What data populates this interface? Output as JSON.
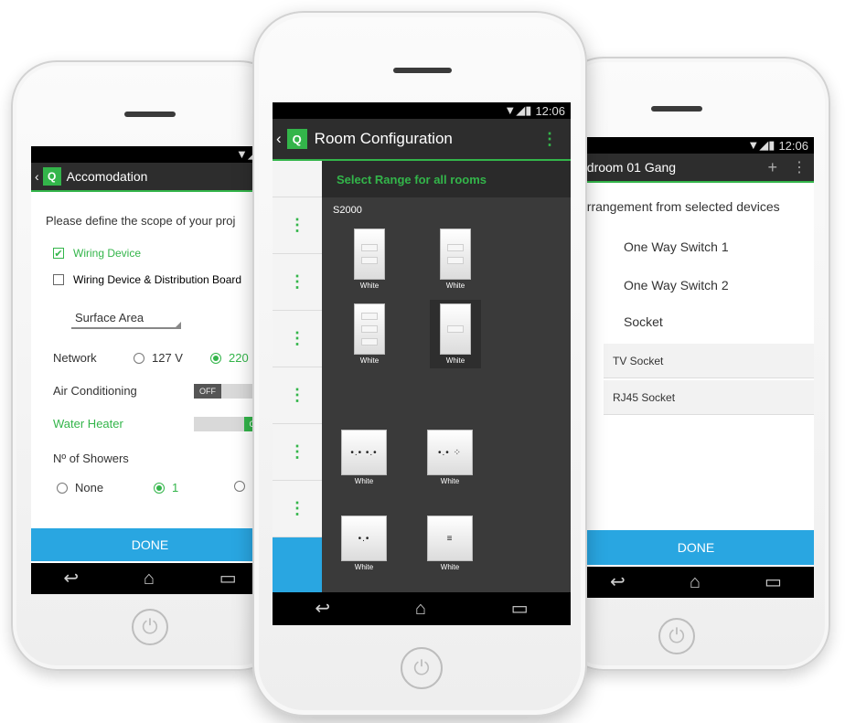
{
  "colors": {
    "accent_green": "#33b54a",
    "done_blue": "#29a6e1",
    "actionbar": "#2d2d2d"
  },
  "left": {
    "status_icons": "▼◢▮",
    "title": "Accomodation",
    "intro": "Please define the scope of your proj",
    "option_wiring": "Wiring Device",
    "option_wiring_board": "Wiring Device & Distribution Board",
    "area_select": "Surface Area",
    "network_label": "Network",
    "network_127": "127 V",
    "network_220": "220",
    "ac_label": "Air Conditioning",
    "ac_toggle": "OFF",
    "heater_label": "Water Heater",
    "heater_toggle": "ON",
    "showers_label": "Nº of Showers",
    "showers_none": "None",
    "showers_one": "1",
    "done": "DONE"
  },
  "center": {
    "status_icons": "▼◢▮",
    "time": "12:06",
    "title": "Room Configuration",
    "header": "Select Range for all rooms",
    "series": "S2000",
    "device_label": "White",
    "devices_count": 8
  },
  "right": {
    "status_icons": "▼◢▮",
    "time": "12:06",
    "title": "edroom 01 Gang",
    "plus": "+",
    "arrangement": "arrangement from selected devices",
    "switch1": "One Way Switch 1",
    "switch2": "One Way Switch 2",
    "socket": "Socket",
    "tv_socket": "TV Socket",
    "rj45_socket": "RJ45 Socket",
    "done": "DONE"
  }
}
